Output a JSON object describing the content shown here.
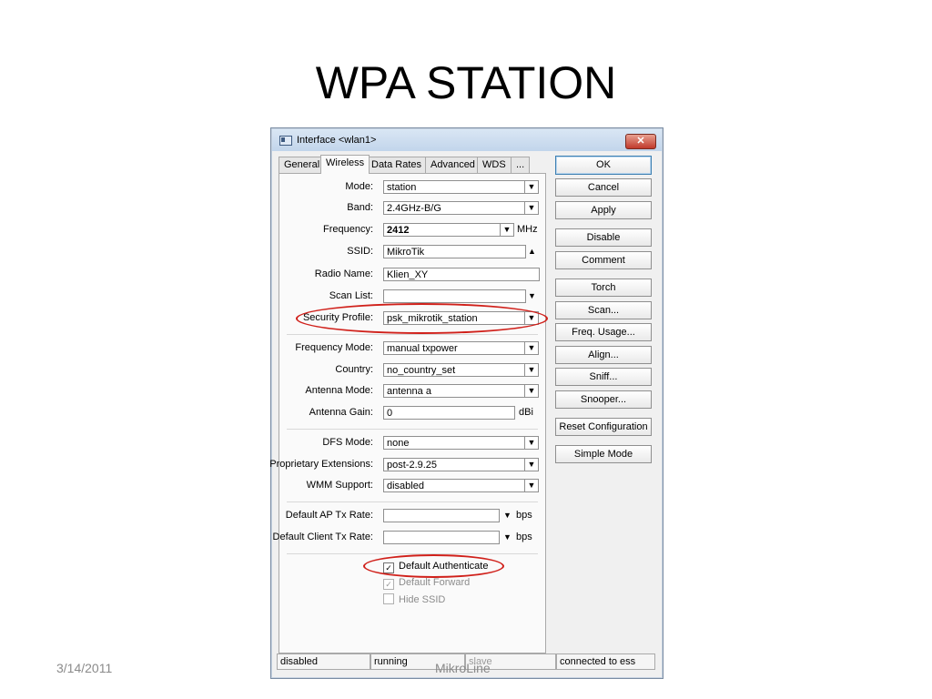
{
  "slide": {
    "title": "WPA STATION",
    "footer_date": "3/14/2011",
    "footer_center": "MikroLine"
  },
  "window": {
    "title": "Interface <wlan1>",
    "close_label": "✕"
  },
  "tabs": [
    {
      "label": "General",
      "active": false
    },
    {
      "label": "Wireless",
      "active": true
    },
    {
      "label": "Data Rates",
      "active": false
    },
    {
      "label": "Advanced",
      "active": false
    },
    {
      "label": "WDS",
      "active": false
    },
    {
      "label": "...",
      "active": false
    }
  ],
  "form": {
    "mode": {
      "label": "Mode:",
      "value": "station"
    },
    "band": {
      "label": "Band:",
      "value": "2.4GHz-B/G"
    },
    "frequency": {
      "label": "Frequency:",
      "value": "2412",
      "unit": "MHz"
    },
    "ssid": {
      "label": "SSID:",
      "value": "MikroTik"
    },
    "radio_name": {
      "label": "Radio Name:",
      "value": "Klien_XY"
    },
    "scan_list": {
      "label": "Scan List:",
      "value": ""
    },
    "security_profile": {
      "label": "Security Profile:",
      "value": "psk_mikrotik_station"
    },
    "frequency_mode": {
      "label": "Frequency Mode:",
      "value": "manual txpower"
    },
    "country": {
      "label": "Country:",
      "value": "no_country_set"
    },
    "antenna_mode": {
      "label": "Antenna Mode:",
      "value": "antenna a"
    },
    "antenna_gain": {
      "label": "Antenna Gain:",
      "value": "0",
      "unit": "dBi"
    },
    "dfs_mode": {
      "label": "DFS Mode:",
      "value": "none"
    },
    "proprietary_extensions": {
      "label": "Proprietary Extensions:",
      "value": "post-2.9.25"
    },
    "wmm_support": {
      "label": "WMM Support:",
      "value": "disabled"
    },
    "default_ap_tx_rate": {
      "label": "Default AP Tx Rate:",
      "value": "",
      "unit": "bps"
    },
    "default_client_tx_rate": {
      "label": "Default Client Tx Rate:",
      "value": "",
      "unit": "bps"
    }
  },
  "checkboxes": {
    "default_authenticate": {
      "label": "Default Authenticate",
      "checked": true,
      "enabled": true
    },
    "default_forward": {
      "label": "Default Forward",
      "checked": true,
      "enabled": false
    },
    "hide_ssid": {
      "label": "Hide SSID",
      "checked": false,
      "enabled": false
    }
  },
  "buttons": {
    "ok": "OK",
    "cancel": "Cancel",
    "apply": "Apply",
    "disable": "Disable",
    "comment": "Comment",
    "torch": "Torch",
    "scan": "Scan...",
    "freq_usage": "Freq. Usage...",
    "align": "Align...",
    "sniff": "Sniff...",
    "snooper": "Snooper...",
    "reset_configuration": "Reset Configuration",
    "simple_mode": "Simple Mode"
  },
  "status_bar": {
    "enabled_state": "disabled",
    "running_state": "running",
    "role": "slave",
    "connection": "connected to ess"
  },
  "glyphs": {
    "dropdown": "▼",
    "dropup": "▲",
    "check": "✓"
  },
  "colors": {
    "highlight_oval": "#d0201a",
    "window_border": "#7a8ca3"
  }
}
